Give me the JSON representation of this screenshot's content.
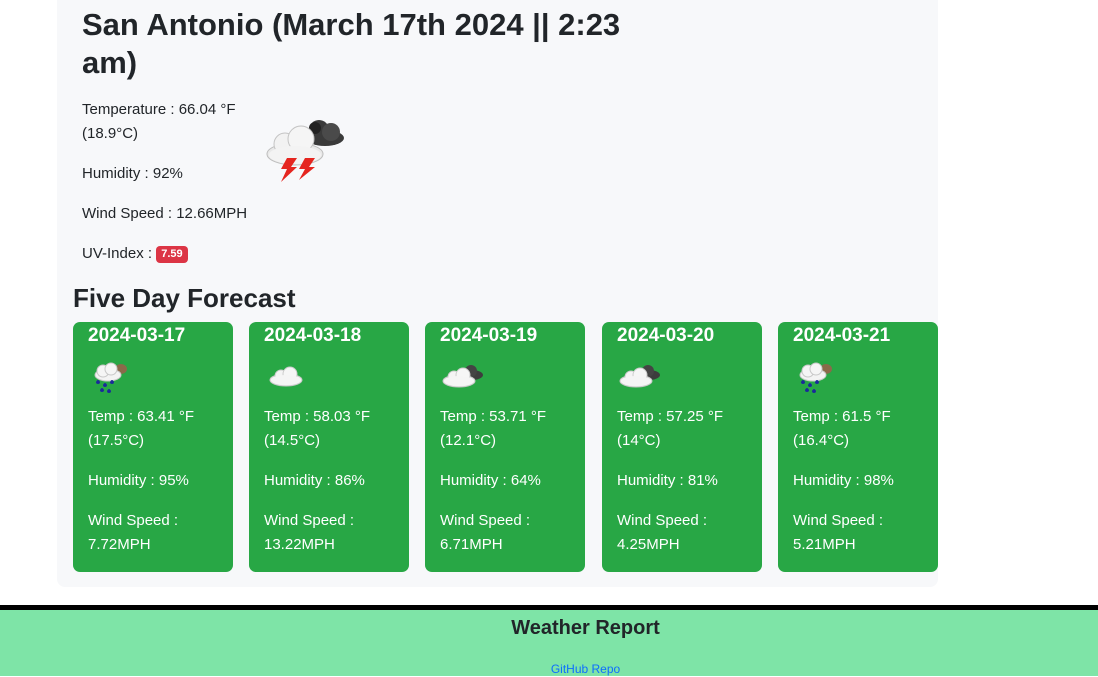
{
  "current": {
    "title": "San Antonio (March 17th 2024 || 2:23 am)",
    "temperature": "Temperature : 66.04 °F (18.9°C)",
    "humidity": "Humidity : 92%",
    "wind": "Wind Speed : 12.66MPH",
    "uv_label": "UV-Index : ",
    "uv_value": "7.59",
    "uv_color": "#dc3545",
    "icon": "thunderstorm-icon"
  },
  "forecast": {
    "title": "Five Day Forecast",
    "card_color": "#28a745",
    "days": [
      {
        "date": "2024-03-17",
        "icon": "rain-icon",
        "temp": "Temp : 63.41 °F (17.5°C)",
        "humidity": "Humidity : 95%",
        "wind": "Wind Speed : 7.72MPH"
      },
      {
        "date": "2024-03-18",
        "icon": "cloud-icon",
        "temp": "Temp : 58.03 °F (14.5°C)",
        "humidity": "Humidity : 86%",
        "wind": "Wind Speed : 13.22MPH"
      },
      {
        "date": "2024-03-19",
        "icon": "broken-clouds-icon",
        "temp": "Temp : 53.71 °F (12.1°C)",
        "humidity": "Humidity : 64%",
        "wind": "Wind Speed : 6.71MPH"
      },
      {
        "date": "2024-03-20",
        "icon": "broken-clouds-icon",
        "temp": "Temp : 57.25 °F (14°C)",
        "humidity": "Humidity : 81%",
        "wind": "Wind Speed : 4.25MPH"
      },
      {
        "date": "2024-03-21",
        "icon": "rain-icon",
        "temp": "Temp : 61.5 °F (16.4°C)",
        "humidity": "Humidity : 98%",
        "wind": "Wind Speed : 5.21MPH"
      }
    ]
  },
  "footer": {
    "title": "Weather Report",
    "link": "GitHub Repo",
    "bg_color": "#7ee4a7"
  }
}
